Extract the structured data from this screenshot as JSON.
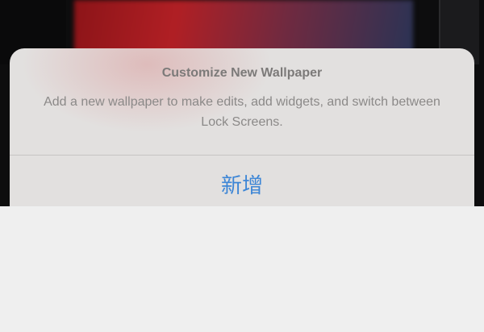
{
  "sheet": {
    "title": "Customize New Wallpaper",
    "message": "Add a new wallpaper to make edits, add widgets, and switch between Lock Screens.",
    "action_label": "新增"
  },
  "colors": {
    "sheet_background": "#e2e0df",
    "action_blue": "#3d86d6",
    "text_gray": "#8b8988"
  }
}
